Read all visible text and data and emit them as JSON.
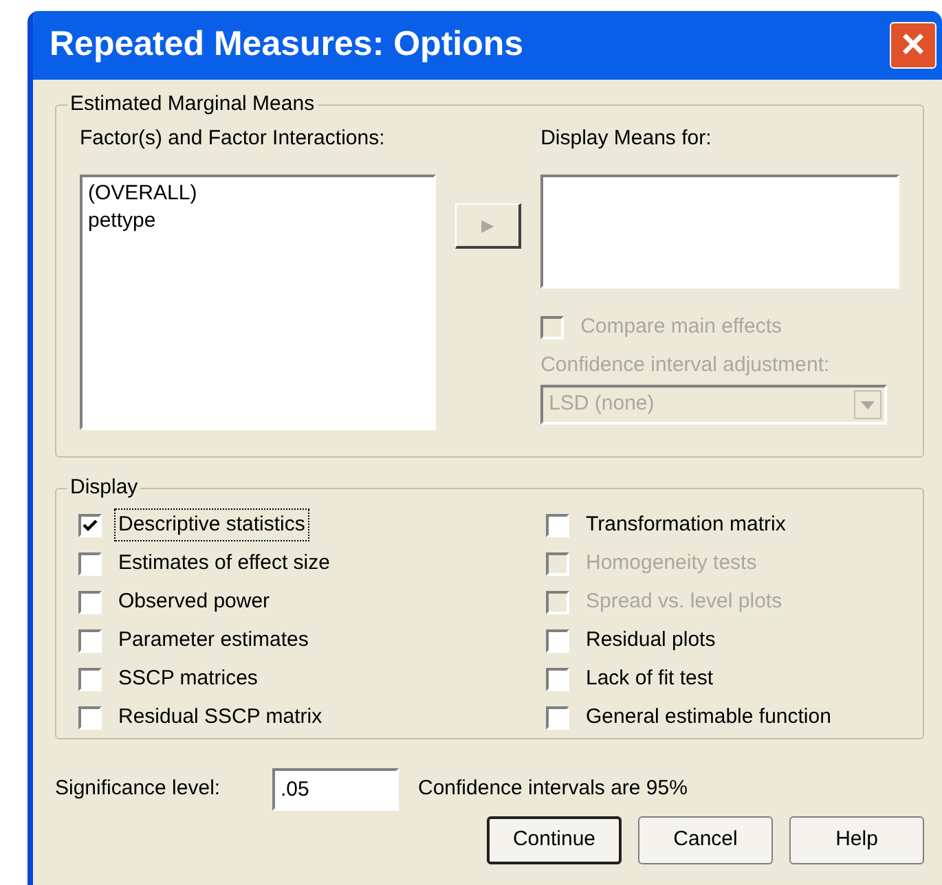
{
  "window": {
    "title": "Repeated Measures: Options",
    "close": "×"
  },
  "estimated_marginal_means": {
    "title": "Estimated Marginal Means",
    "factors_label": "Factor(s) and Factor Interactions:",
    "factors": [
      "(OVERALL)",
      "pettype"
    ],
    "move_button": {
      "label": "▶",
      "disabled": true
    },
    "display_means_label": "Display Means for:",
    "compare_main_effects": {
      "label": "Compare main effects",
      "checked": false,
      "disabled": true
    },
    "adjustment_label": "Confidence interval adjustment:",
    "adjustment": {
      "value": "LSD (none)",
      "disabled": true
    }
  },
  "display": {
    "title": "Display",
    "options": [
      {
        "label": "Descriptive statistics",
        "checked": true,
        "disabled": false,
        "focused": true
      },
      {
        "label": "Estimates of effect size",
        "checked": false,
        "disabled": false,
        "focused": false
      },
      {
        "label": "Observed power",
        "checked": false,
        "disabled": false,
        "focused": false
      },
      {
        "label": "Parameter estimates",
        "checked": false,
        "disabled": false,
        "focused": false
      },
      {
        "label": "SSCP matrices",
        "checked": false,
        "disabled": false,
        "focused": false
      },
      {
        "label": "Residual SSCP matrix",
        "checked": false,
        "disabled": false,
        "focused": false
      },
      {
        "label": "Transformation matrix",
        "checked": false,
        "disabled": false,
        "focused": false
      },
      {
        "label": "Homogeneity tests",
        "checked": false,
        "disabled": true,
        "focused": false
      },
      {
        "label": "Spread vs. level plots",
        "checked": false,
        "disabled": true,
        "focused": false
      },
      {
        "label": "Residual plots",
        "checked": false,
        "disabled": false,
        "focused": false
      },
      {
        "label": "Lack of fit test",
        "checked": false,
        "disabled": false,
        "focused": false
      },
      {
        "label": "General estimable function",
        "checked": false,
        "disabled": false,
        "focused": false
      }
    ]
  },
  "significance": {
    "label": "Significance level:",
    "value": ".05",
    "note": "Confidence intervals are 95%"
  },
  "buttons": [
    {
      "label": "Continue",
      "default": true
    },
    {
      "label": "Cancel",
      "default": false
    },
    {
      "label": "Help",
      "default": false
    }
  ]
}
